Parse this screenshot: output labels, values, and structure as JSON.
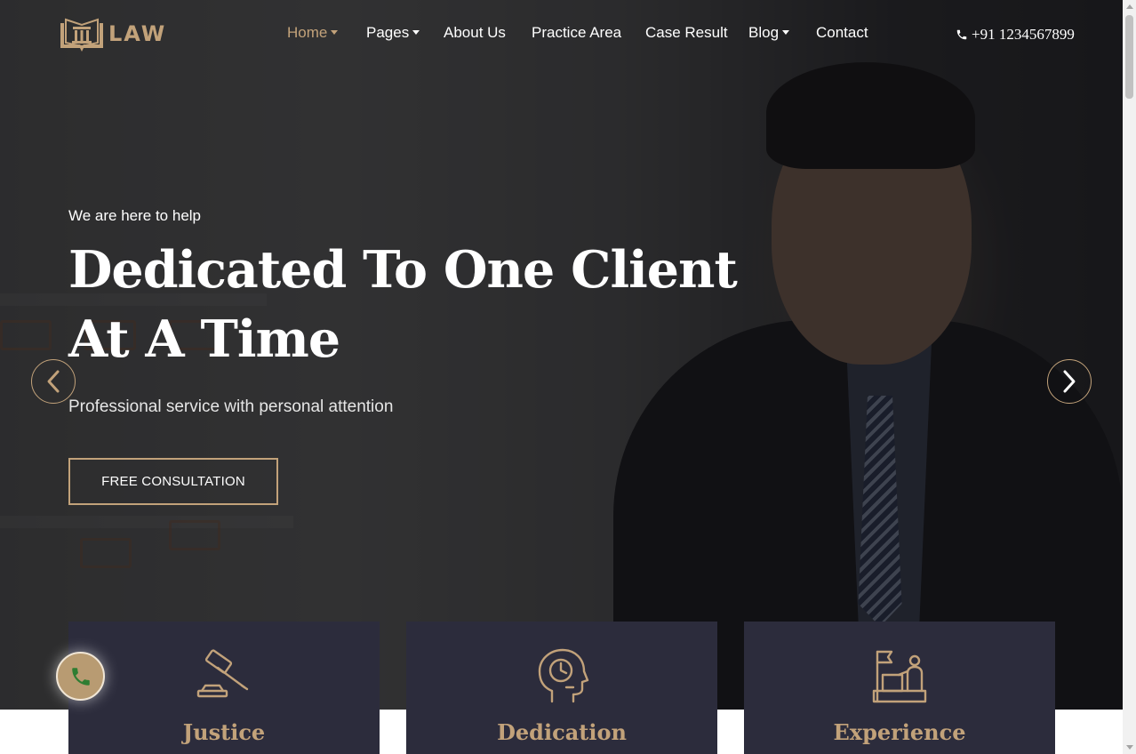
{
  "brand": {
    "logo_text": "LAW",
    "accent_color": "#c2a27a"
  },
  "nav": {
    "items": [
      {
        "label": "Home",
        "dropdown": true,
        "active": true
      },
      {
        "label": "Pages",
        "dropdown": true
      },
      {
        "label": "About Us"
      },
      {
        "label": "Practice Area"
      },
      {
        "label": "Case Result"
      },
      {
        "label": "Blog",
        "dropdown": true
      },
      {
        "label": "Contact"
      }
    ],
    "phone": "+91 1234567899",
    "phone_icon": "phone-icon"
  },
  "hero": {
    "tagline": "We are here to help",
    "headline_line1": "Dedicated To One Client",
    "headline_line2": "At A Time",
    "subline": "Professional service with personal attention",
    "cta_label": "FREE CONSULTATION",
    "prev_icon": "chevron-left-icon",
    "next_icon": "chevron-right-icon"
  },
  "features": [
    {
      "title": "Justice",
      "icon": "gavel-icon"
    },
    {
      "title": "Dedication",
      "icon": "head-clock-icon"
    },
    {
      "title": "Experience",
      "icon": "podium-icon"
    }
  ],
  "floating_call": {
    "icon": "phone-icon",
    "color": "#2e7d32"
  }
}
